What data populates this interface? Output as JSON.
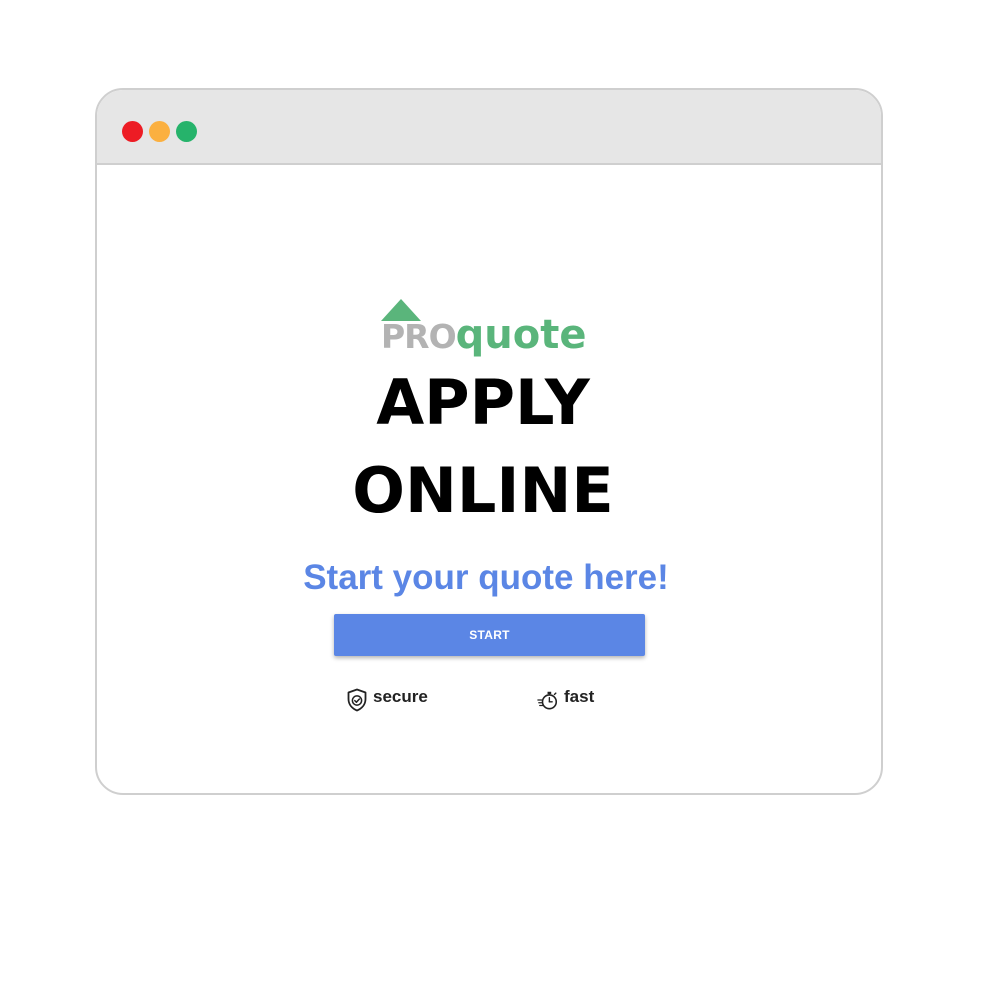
{
  "window": {
    "controls": [
      {
        "name": "close",
        "color": "#ed1c24"
      },
      {
        "name": "minimize",
        "color": "#fbb040"
      },
      {
        "name": "zoom",
        "color": "#26b36b"
      }
    ],
    "titlebar_color": "#e6e6e6"
  },
  "logo": {
    "pro": "PRO",
    "quote": "quote",
    "pro_color": "#b3b3b3",
    "quote_color": "#5ab57b",
    "triangle_color": "#5ab57b"
  },
  "headline": {
    "line1": "APPLY",
    "line2": "ONLINE"
  },
  "subtitle": {
    "text": "Start your quote here!",
    "color": "#5b86e5"
  },
  "start_button": {
    "label": "START",
    "color": "#5b86e5"
  },
  "features": [
    {
      "icon": "shield-check-icon",
      "label": "secure"
    },
    {
      "icon": "stopwatch-icon",
      "label": "fast"
    }
  ]
}
